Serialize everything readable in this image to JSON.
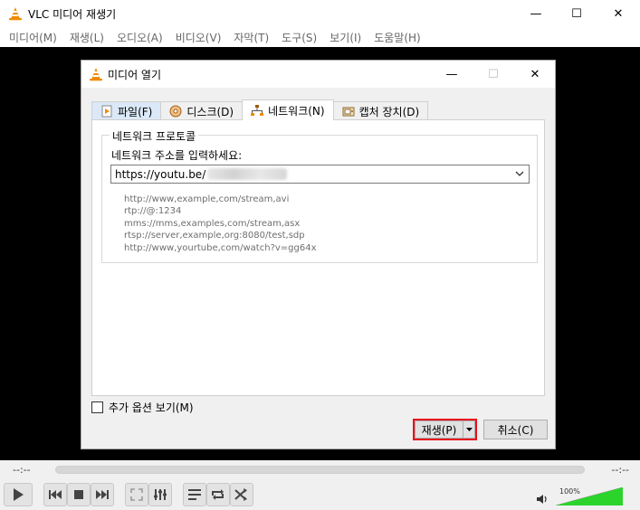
{
  "window": {
    "title": "VLC 미디어 재생기",
    "minimize": "—",
    "maximize": "☐",
    "close": "✕"
  },
  "menubar": [
    "미디어(M)",
    "재생(L)",
    "오디오(A)",
    "비디오(V)",
    "자막(T)",
    "도구(S)",
    "보기(I)",
    "도움말(H)"
  ],
  "player": {
    "time_elapsed": "--:--",
    "time_total": "--:--",
    "volume_percent": "100%",
    "volume_level": 1.0
  },
  "dialog": {
    "title": "미디어 열기",
    "tabs": [
      {
        "label": "파일(F)",
        "icon": "file-play-icon"
      },
      {
        "label": "디스크(D)",
        "icon": "disc-icon"
      },
      {
        "label": "네트워크(N)",
        "icon": "network-icon",
        "selected": true
      },
      {
        "label": "캡처 장치(D)",
        "icon": "capture-device-icon"
      }
    ],
    "group_title": "네트워크 프로토콜",
    "url_prompt": "네트워크 주소를 입력하세요:",
    "url_value": "https://youtu.be/",
    "examples": [
      "http://www,example,com/stream,avi",
      "rtp://@:1234",
      "mms://mms,examples,com/stream,asx",
      "rtsp://server,example,org:8080/test,sdp",
      "http://www,yourtube,com/watch?v=gg64x"
    ],
    "more_options_label": "추가 옵션 보기(M)",
    "more_options_checked": false,
    "play_label": "재생(P)",
    "cancel_label": "취소(C)"
  },
  "colors": {
    "highlight_border": "#e8101c",
    "volume_green": "#2bd42b"
  }
}
